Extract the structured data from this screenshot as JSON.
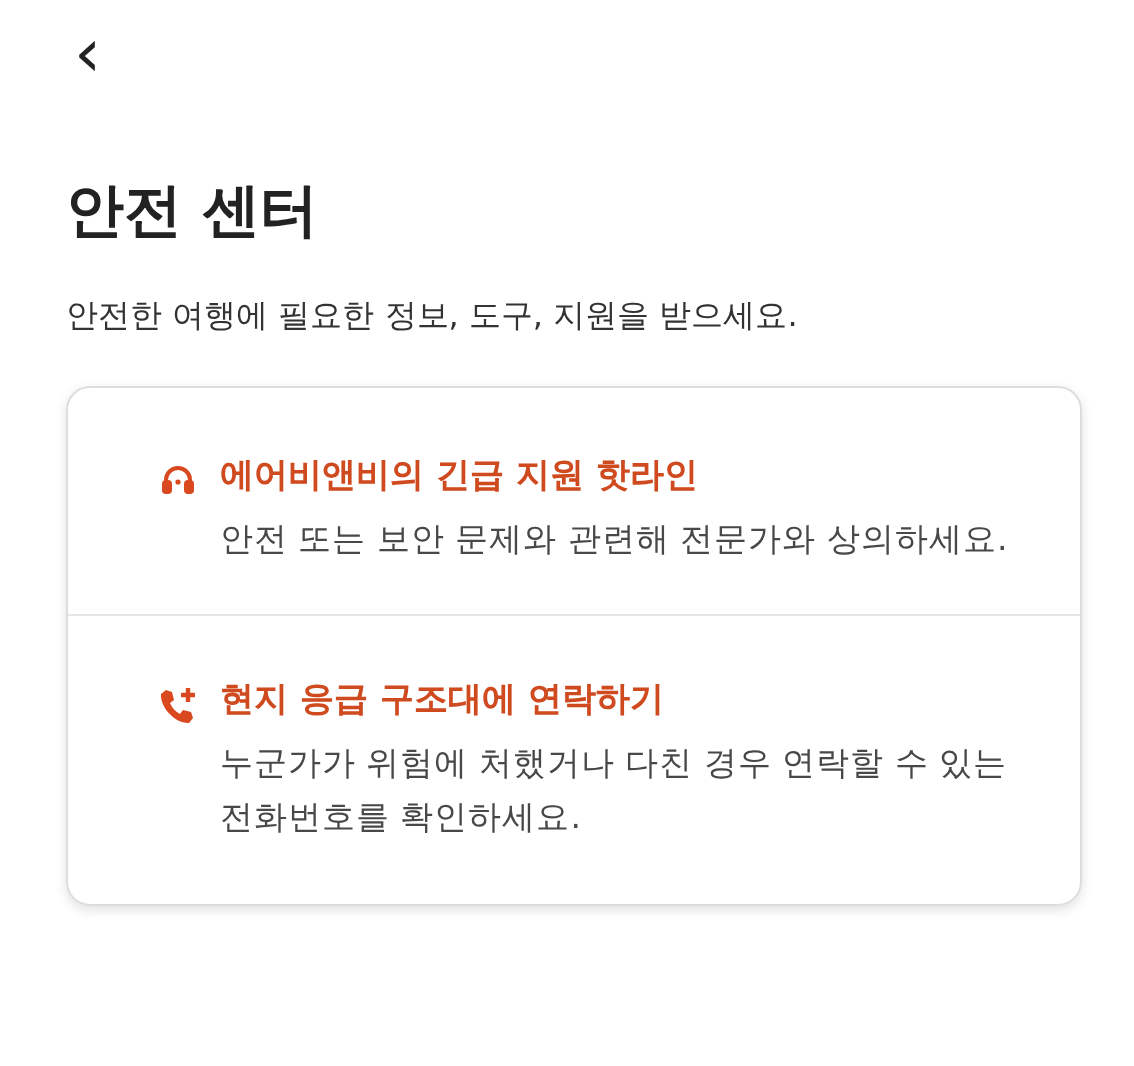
{
  "header": {
    "back": "‹"
  },
  "title": "안전 센터",
  "subtitle": "안전한 여행에 필요한 정보, 도구, 지원을 받으세요.",
  "items": [
    {
      "kind": "headset",
      "title": "에어비앤비의 긴급 지원 핫라인",
      "description": "안전 또는 보안 문제와 관련해 전문가와 상의하세요."
    },
    {
      "kind": "phone",
      "title": "현지 응급 구조대에 연락하기",
      "description": "누군가가 위험에 처했거나 다친 경우 연락할 수 있는 전화번호를 확인하세요."
    }
  ]
}
